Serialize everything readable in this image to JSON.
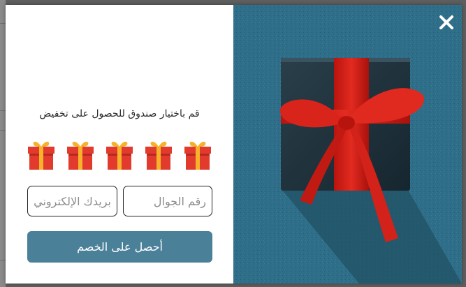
{
  "popup": {
    "heading": "قم باختيار صندوق للحصول على تخفيض",
    "gift_boxes": [
      "gift-1",
      "gift-2",
      "gift-3",
      "gift-4",
      "gift-5"
    ],
    "email_placeholder": "بريدك الإلكتروني",
    "phone_placeholder": "رقم الجوال",
    "submit_label": "أحصل على الخصم",
    "close_icon": "close-icon",
    "image_description_icon": "gift-box-image"
  },
  "colors": {
    "accent": "#4b8099",
    "image_background": "#2f6e88",
    "ribbon": "#d7261e",
    "gift_red": "#e23b2e",
    "gift_yellow": "#f6b22b"
  }
}
